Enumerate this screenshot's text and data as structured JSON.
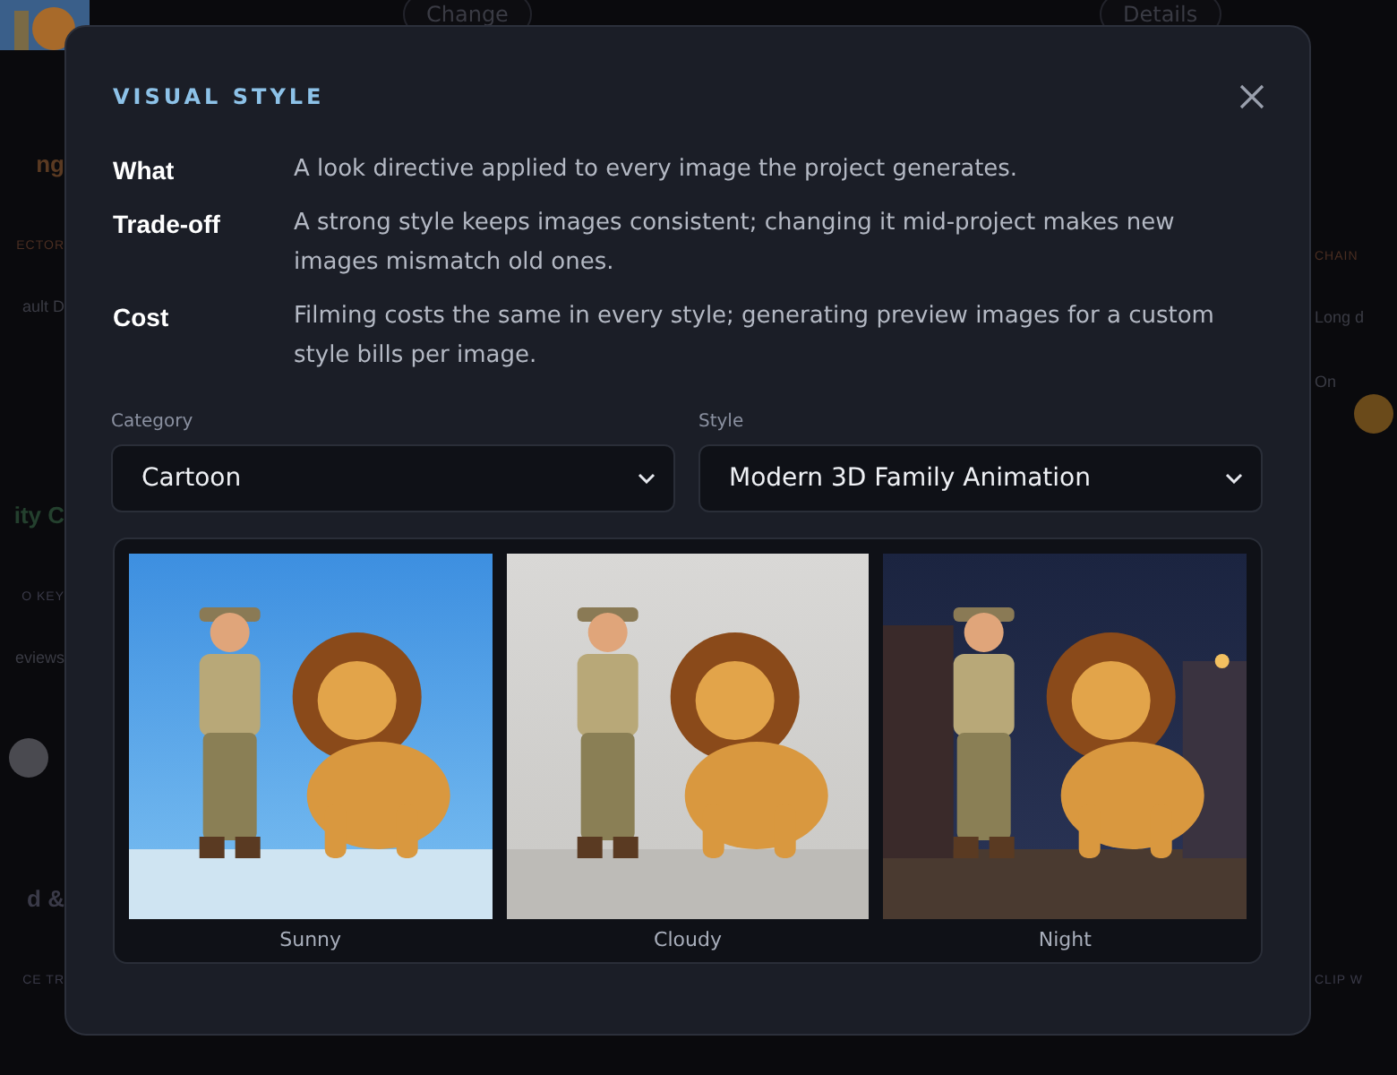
{
  "background": {
    "top_buttons": [
      "Change",
      "Details"
    ],
    "left": [
      {
        "kind": "heading",
        "text": "ng",
        "color": "#5a3a22"
      },
      {
        "kind": "label",
        "text": "ECTOR",
        "color": "#4a2e22"
      },
      {
        "kind": "text",
        "text": "ault D"
      },
      {
        "kind": "heading",
        "text": "ity C",
        "color": "#24402e"
      },
      {
        "kind": "label",
        "text": "O KEY",
        "color": "#3a3a48"
      },
      {
        "kind": "text",
        "text": "eviews"
      },
      {
        "kind": "toggle",
        "on": false
      },
      {
        "kind": "heading",
        "text": "d &",
        "color": "#3a3a48"
      },
      {
        "kind": "label",
        "text": "CE TR",
        "color": "#3a3a48"
      }
    ],
    "right": [
      {
        "kind": "label",
        "text": "CHAIN",
        "color": "#4a2e22"
      },
      {
        "kind": "text",
        "text": "Long d"
      },
      {
        "kind": "toggle",
        "on": true,
        "text": "On"
      },
      {
        "kind": "label",
        "text": "CLIP W",
        "color": "#3a3a48"
      }
    ]
  },
  "dialog": {
    "title": "VISUAL STYLE",
    "facts": [
      {
        "term": "What",
        "text": "A look directive applied to every image the project generates."
      },
      {
        "term": "Trade-off",
        "text": "A strong style keeps images consistent; changing it mid-project makes new images mismatch old ones."
      },
      {
        "term": "Cost",
        "text": "Filming costs the same in every style; generating preview images for a custom style bills per image."
      }
    ],
    "fields": [
      {
        "label": "Category",
        "value": "Cartoon"
      },
      {
        "label": "Style",
        "value": "Modern 3D Family Animation"
      }
    ],
    "previews": [
      {
        "caption": "Sunny"
      },
      {
        "caption": "Cloudy"
      },
      {
        "caption": "Night"
      }
    ]
  }
}
